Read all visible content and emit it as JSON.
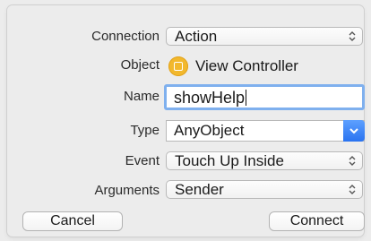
{
  "dialog": {
    "connection": {
      "label": "Connection",
      "value": "Action"
    },
    "object": {
      "label": "Object",
      "value": "View Controller"
    },
    "name": {
      "label": "Name",
      "value": "showHelp"
    },
    "type": {
      "label": "Type",
      "value": "AnyObject"
    },
    "event": {
      "label": "Event",
      "value": "Touch Up Inside"
    },
    "arguments": {
      "label": "Arguments",
      "value": "Sender"
    }
  },
  "buttons": {
    "cancel": "Cancel",
    "connect": "Connect"
  },
  "colors": {
    "focus_ring": "#7fb0ee",
    "accent_blue": "#2a73f0",
    "object_icon": "#f2b82d"
  },
  "icons": [
    "stepper-icon",
    "chevron-down-icon",
    "view-controller-icon"
  ]
}
